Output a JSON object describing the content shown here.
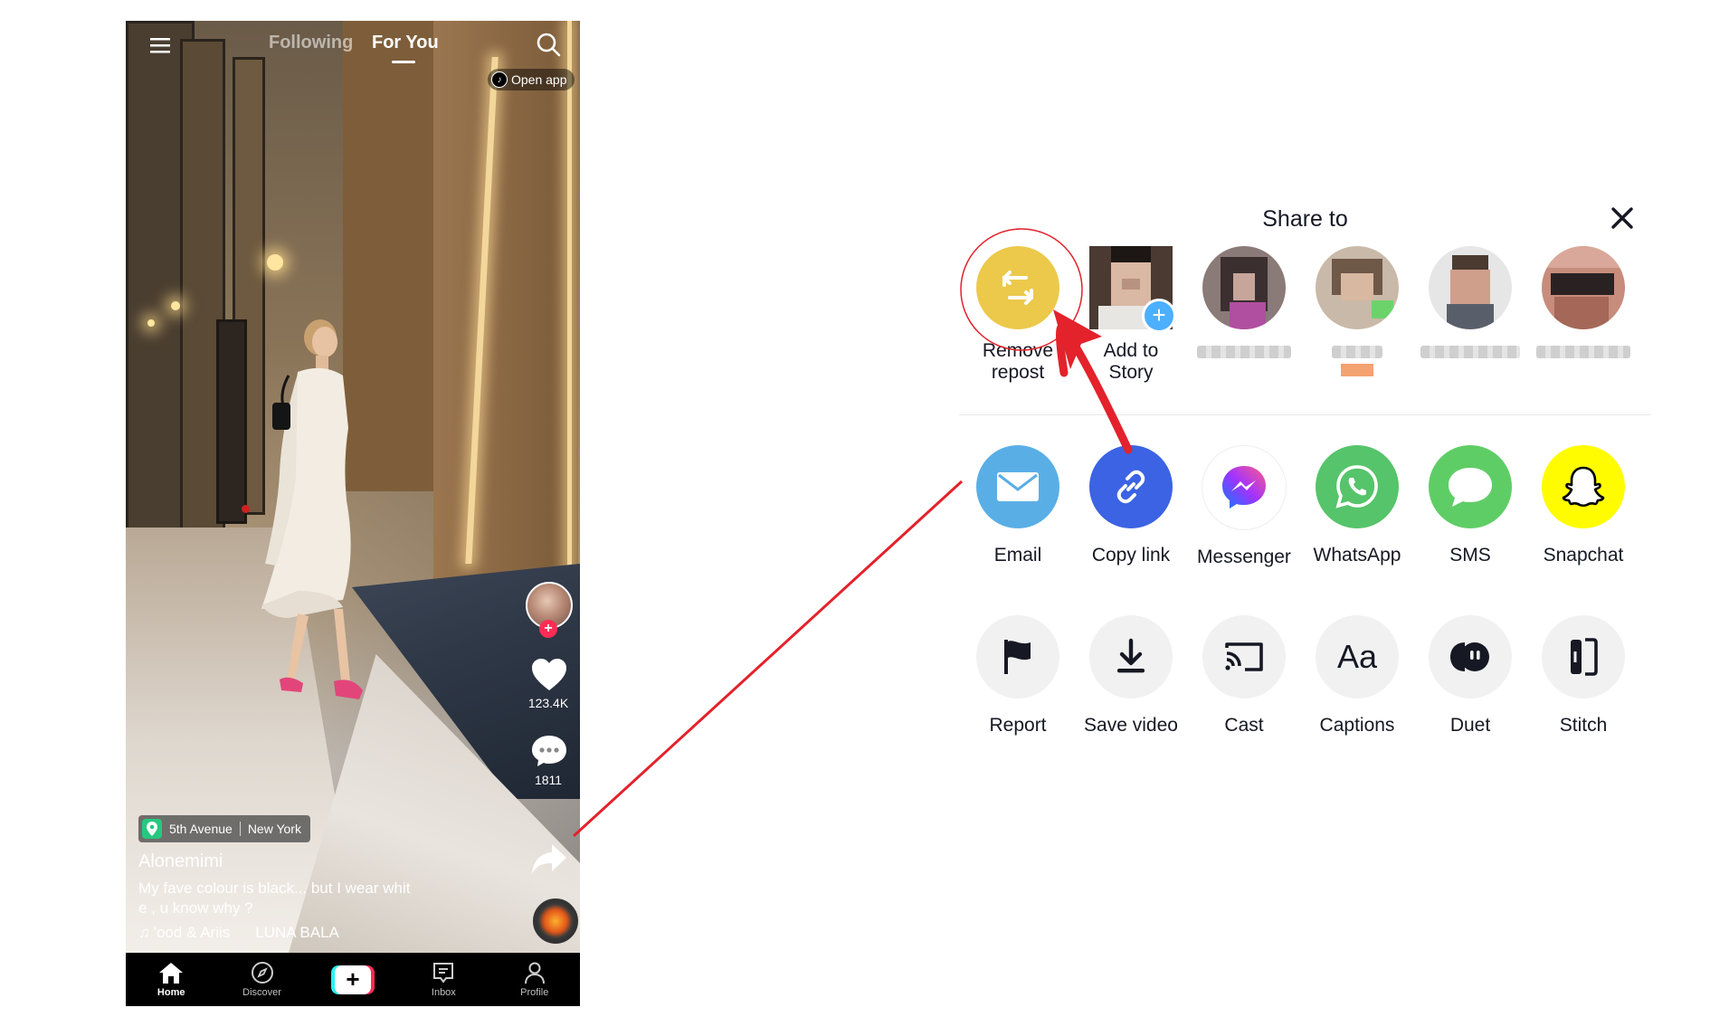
{
  "phone": {
    "tabs": {
      "following": "Following",
      "for_you": "For You"
    },
    "open_app": "Open app",
    "likes": "123.4K",
    "comments": "1811",
    "location": {
      "place": "5th Avenue",
      "city": "New York"
    },
    "username": "Alonemimi",
    "caption_line1": "My fave colour is black... but I wear whit",
    "caption_line2": "e , u know why ?",
    "music_a": "'ood & Ariis",
    "music_b": "LUNA BALA",
    "nav": {
      "home": "Home",
      "discover": "Discover",
      "inbox": "Inbox",
      "profile": "Profile"
    }
  },
  "share_sheet": {
    "title": "Share to",
    "top_row": {
      "remove_repost_line1": "Remove",
      "remove_repost_line2": "repost",
      "add_story_line1": "Add to",
      "add_story_line2": "Story"
    },
    "apps": [
      {
        "label": "Email",
        "color": "#5aaee6"
      },
      {
        "label": "Copy link",
        "color": "#3b63e3"
      },
      {
        "label": "Messenger",
        "color": "#ffffff"
      },
      {
        "label": "WhatsApp",
        "color": "#56c46a"
      },
      {
        "label": "SMS",
        "color": "#5fcd66"
      },
      {
        "label": "Snapchat",
        "color": "#fffc00"
      }
    ],
    "actions": [
      {
        "label": "Report"
      },
      {
        "label": "Save video"
      },
      {
        "label": "Cast"
      },
      {
        "label": "Captions",
        "glyph": "Aa"
      },
      {
        "label": "Duet"
      },
      {
        "label": "Stitch"
      }
    ]
  },
  "colors": {
    "accent_red": "#e3222b",
    "repost_yellow": "#ecc94b",
    "tiktok_pink": "#fe2c55",
    "tiktok_cyan": "#25f4ee"
  }
}
